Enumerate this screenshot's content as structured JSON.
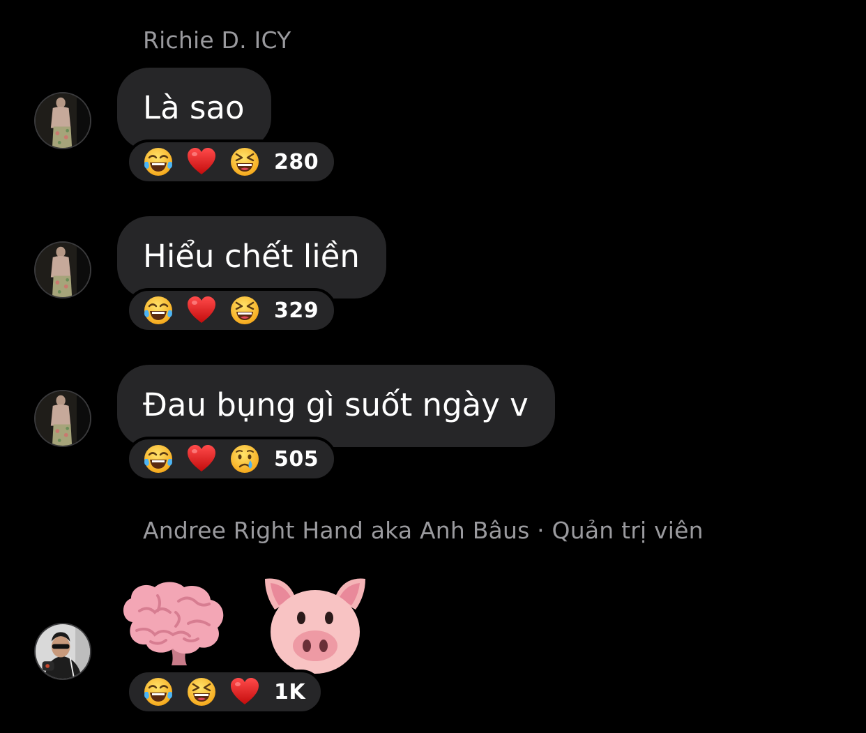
{
  "messages": [
    {
      "sender": "Richie D. ICY",
      "text": "Là sao",
      "reactions": {
        "emojis": [
          "laughing-tears",
          "red-heart",
          "grinning-squint"
        ],
        "count": "280"
      }
    },
    {
      "text": "Hiểu chết liền",
      "reactions": {
        "emojis": [
          "laughing-tears",
          "red-heart",
          "grinning-squint"
        ],
        "count": "329"
      }
    },
    {
      "text": "Đau bụng gì suốt ngày v",
      "reactions": {
        "emojis": [
          "laughing-tears",
          "red-heart",
          "crying-face"
        ],
        "count": "505"
      }
    },
    {
      "sender": "Andree Right Hand aka Anh Bâus · Quản trị viên",
      "stickers": [
        "brain-emoji",
        "pig-emoji"
      ],
      "reactions": {
        "emojis": [
          "laughing-tears",
          "grinning-squint",
          "red-heart"
        ],
        "count": "1K"
      }
    }
  ],
  "colors": {
    "background": "#000000",
    "bubble": "#262628",
    "sender_text": "#9a9a9e"
  }
}
